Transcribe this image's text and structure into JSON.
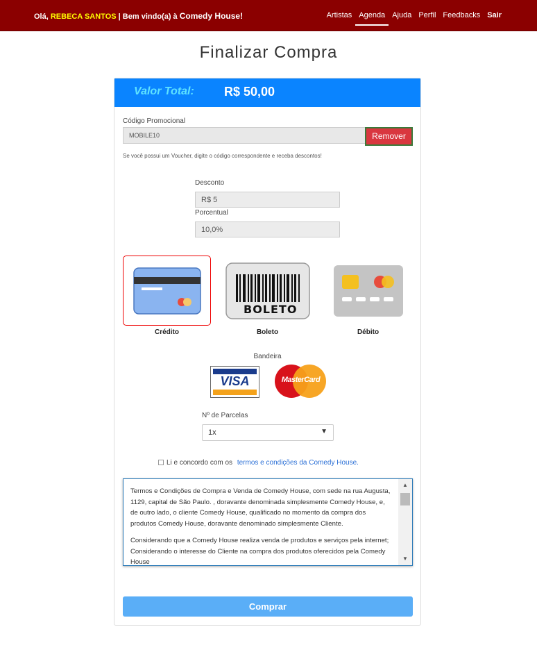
{
  "header": {
    "greeting_prefix": "Olá,",
    "user_name": "REBECA SANTOS",
    "greeting_mid": "| Bem vindo(a) à",
    "brand": "Comedy House!",
    "nav": [
      {
        "label": "Artistas"
      },
      {
        "label": "Agenda",
        "active": true
      },
      {
        "label": "Ajuda"
      },
      {
        "label": "Perfil"
      },
      {
        "label": "Feedbacks"
      },
      {
        "label": "Sair"
      }
    ]
  },
  "page": {
    "title": "Finalizar Compra"
  },
  "summary": {
    "total_label": "Valor Total:",
    "total_value": "R$ 50,00"
  },
  "promo": {
    "label": "Código Promocional",
    "value": "MOBILE10",
    "remove_label": "Remover",
    "hint": "Se você possui um Voucher, digite o código correspondente e receba descontos!"
  },
  "discount": {
    "discount_label": "Desconto",
    "discount_value": "R$ 5",
    "percent_label": "Porcentual",
    "percent_value": "10,0%"
  },
  "payment": {
    "options": [
      {
        "label": "Crédito",
        "selected": true
      },
      {
        "label": "Boleto"
      },
      {
        "label": "Débito"
      }
    ],
    "boleto_text": "BOLETO"
  },
  "brands": {
    "label": "Bandeira",
    "visa": "VISA",
    "mastercard": "MasterCard"
  },
  "installments": {
    "label": "Nº de Parcelas",
    "value": "1x"
  },
  "terms": {
    "agree_text": "Li e concordo com os",
    "link_text": "termos e condições da Comedy House.",
    "paragraphs": [
      "Termos e Condições de Compra e Venda de Comedy House, com sede na rua Augusta, 1129, capital de São Paulo. , doravante denominada simplesmente Comedy House, e, de outro lado, o cliente Comedy House, qualificado no momento da compra dos produtos Comedy House, doravante denominado simplesmente Cliente.",
      "Considerando que a Comedy House realiza venda de produtos e serviços pela internet; Considerando o interesse do Cliente na compra dos produtos oferecidos pela Comedy House"
    ]
  },
  "actions": {
    "buy_label": "Comprar"
  },
  "colors": {
    "header_bg": "#8b0000",
    "summary_bg": "#0a84ff",
    "remove_bg": "#d9373f",
    "buy_bg": "#5aaef7",
    "link": "#2a6fd6"
  }
}
